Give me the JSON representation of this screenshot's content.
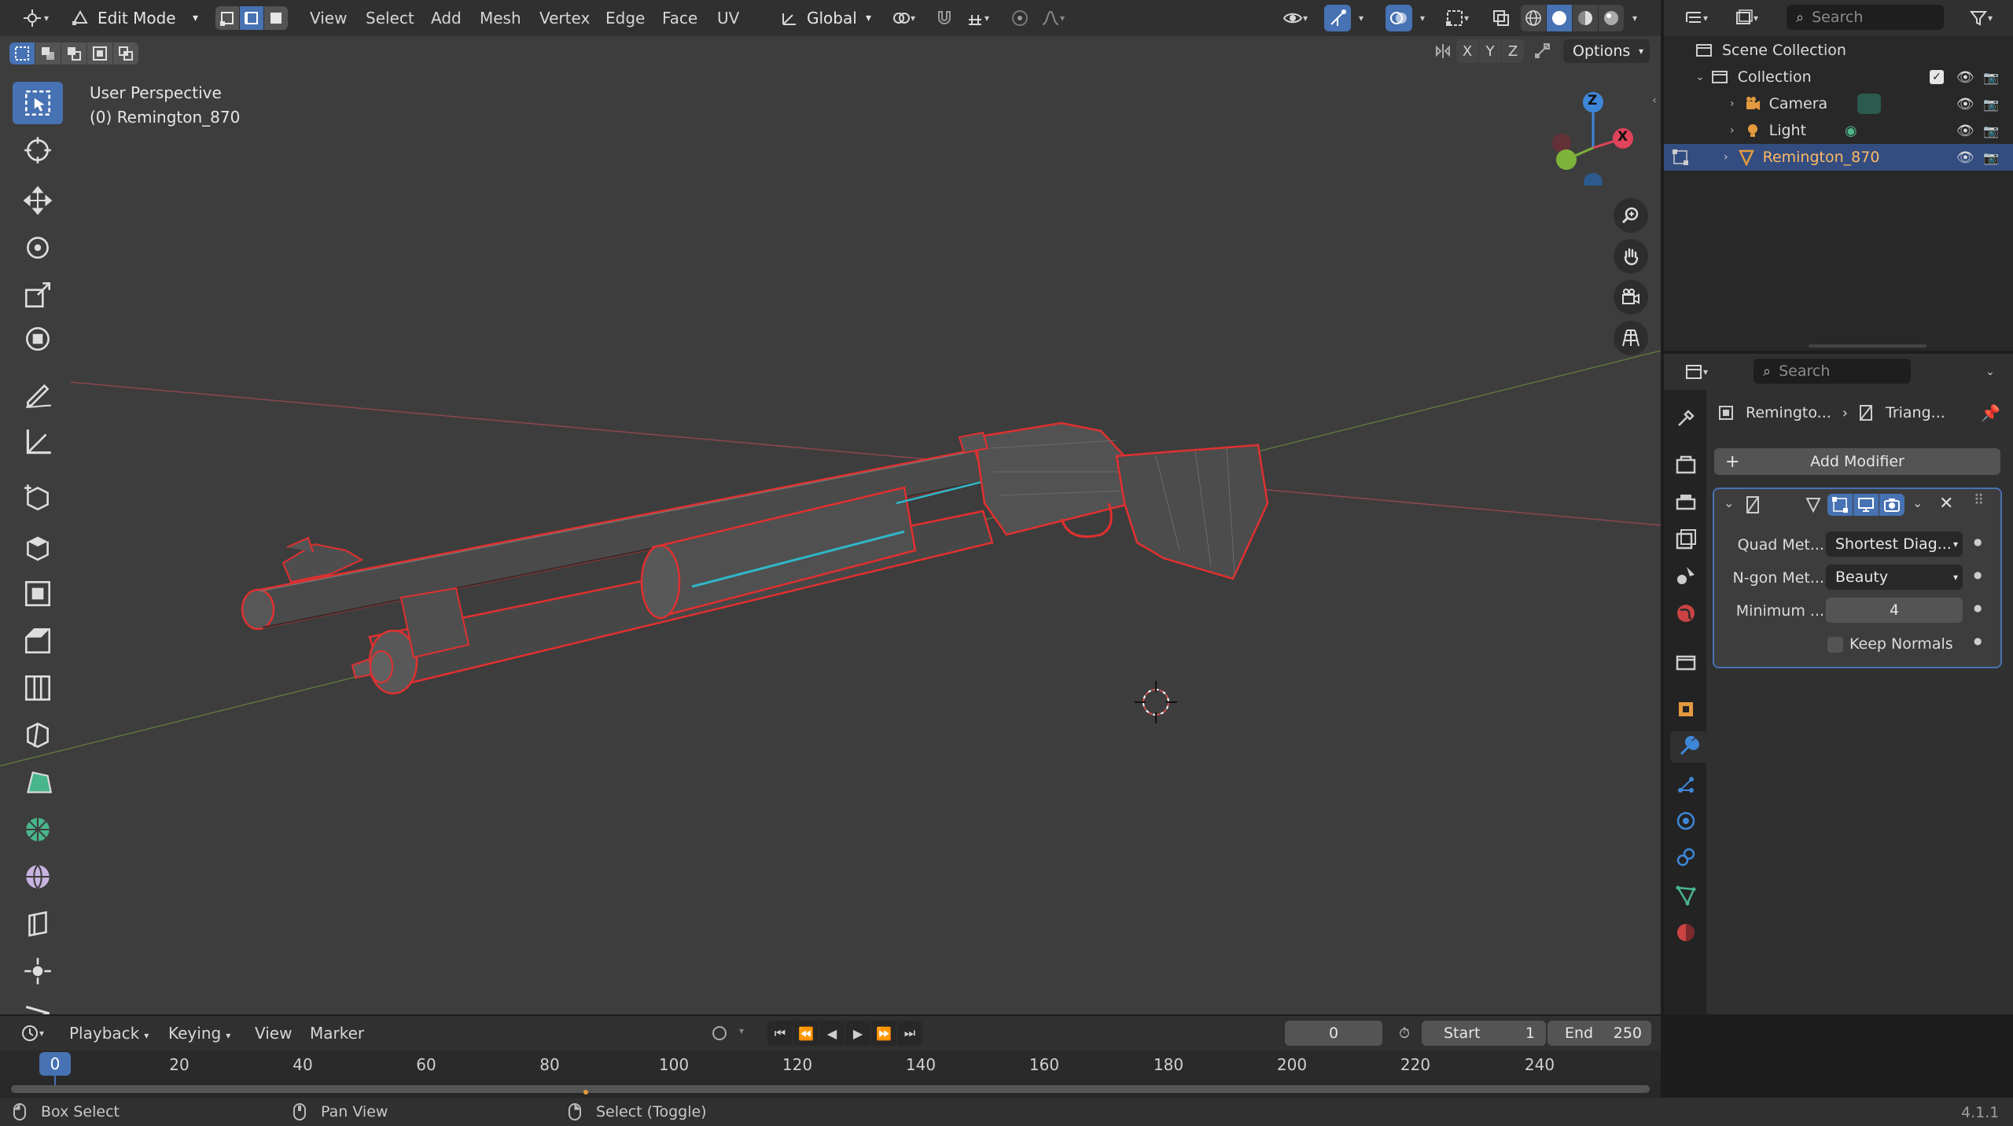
{
  "header": {
    "mode": "Edit Mode",
    "menus": [
      "View",
      "Select",
      "Add",
      "Mesh",
      "Vertex",
      "Edge",
      "Face",
      "UV"
    ],
    "orientation": "Global",
    "axes": [
      "X",
      "Y",
      "Z"
    ],
    "options": "Options"
  },
  "viewport": {
    "view_name": "User Perspective",
    "object_label": "(0) Remington_870",
    "gizmo_axes": {
      "z": "Z",
      "x": "X"
    }
  },
  "outliner": {
    "search_placeholder": "Search",
    "scene_collection": "Scene Collection",
    "collection": "Collection",
    "items": [
      {
        "name": "Camera",
        "icon": "camera-icon"
      },
      {
        "name": "Light",
        "icon": "light-icon"
      },
      {
        "name": "Remington_870",
        "icon": "mesh-icon",
        "selected": true
      }
    ]
  },
  "properties": {
    "search_placeholder": "Search",
    "breadcrumb_object": "Remingto...",
    "breadcrumb_modifier": "Triang...",
    "add_modifier": "Add Modifier",
    "modifier": {
      "quad_label": "Quad Met...",
      "quad_value": "Shortest Diag...",
      "ngon_label": "N-gon Met...",
      "ngon_value": "Beauty",
      "min_label": "Minimum ...",
      "min_value": "4",
      "keep_normals": "Keep Normals"
    }
  },
  "timeline": {
    "menus": [
      "Playback",
      "Keying",
      "View",
      "Marker"
    ],
    "current_frame": "0",
    "start_label": "Start",
    "start_value": "1",
    "end_label": "End",
    "end_value": "250",
    "playhead": "0",
    "ticks": [
      "20",
      "40",
      "60",
      "80",
      "100",
      "120",
      "140",
      "160",
      "180",
      "200",
      "220",
      "240"
    ]
  },
  "statusbar": {
    "box_select": "Box Select",
    "pan_view": "Pan View",
    "select_toggle": "Select (Toggle)",
    "version": "4.1.1"
  },
  "colors": {
    "accent": "#4772b3",
    "selected_row": "#334d80",
    "edge_select": "#e03030",
    "seam": "#2fb7c8",
    "axis_x": "#e0435a",
    "axis_y": "#7fb23a",
    "axis_z": "#3e87d8"
  }
}
